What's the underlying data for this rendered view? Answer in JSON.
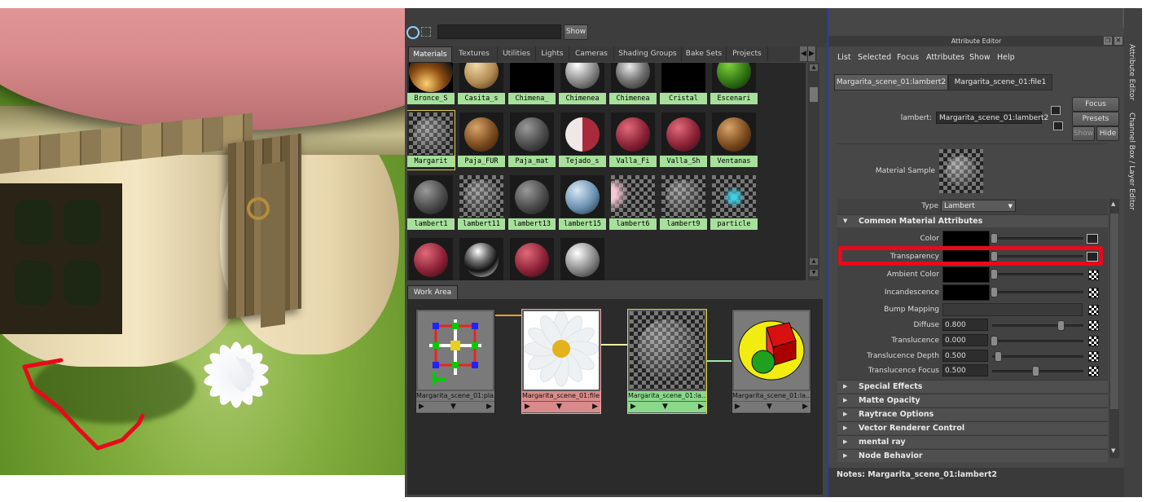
{
  "hypershade": {
    "show_button": "Show",
    "tabs": [
      "Materials",
      "Textures",
      "Utilities",
      "Lights",
      "Cameras",
      "Shading Groups",
      "Bake Sets",
      "Projects"
    ],
    "swatches": [
      {
        "label": "Bronce_S",
        "kind": "bronze"
      },
      {
        "label": "Casita_s",
        "kind": "tan"
      },
      {
        "label": "Chimena_",
        "kind": "black"
      },
      {
        "label": "Chimenea",
        "kind": "stone"
      },
      {
        "label": "Chimenea",
        "kind": "stone2"
      },
      {
        "label": "Cristal",
        "kind": "black"
      },
      {
        "label": "Escenari",
        "kind": "green"
      },
      {
        "label": "Margarit",
        "kind": "checker-ball"
      },
      {
        "label": "Paja_FUR",
        "kind": "wood"
      },
      {
        "label": "Paja_mat",
        "kind": "grey"
      },
      {
        "label": "Tejado_s",
        "kind": "red-white"
      },
      {
        "label": "Valla_Fi",
        "kind": "red"
      },
      {
        "label": "Valla_Sh",
        "kind": "red"
      },
      {
        "label": "Ventanas",
        "kind": "wood"
      },
      {
        "label": "lambert1",
        "kind": "grey"
      },
      {
        "label": "lambert11",
        "kind": "checker"
      },
      {
        "label": "lambert13",
        "kind": "grey"
      },
      {
        "label": "lambert15",
        "kind": "blue"
      },
      {
        "label": "lambert6",
        "kind": "checker-pink"
      },
      {
        "label": "lambert9",
        "kind": "checker"
      },
      {
        "label": "particle",
        "kind": "checker-cyan"
      },
      {
        "label": "",
        "kind": "red"
      },
      {
        "label": "",
        "kind": "chrome"
      },
      {
        "label": "",
        "kind": "red"
      },
      {
        "label": "",
        "kind": "stone"
      }
    ],
    "work_area_tab": "Work Area",
    "nodes": [
      {
        "label": "Margarita_scene_01:pla...",
        "type": "place2d"
      },
      {
        "label": "Margarita_scene_01:file1",
        "type": "file"
      },
      {
        "label": "Margarita_scene_01:la...",
        "type": "lambert"
      },
      {
        "label": "Margarita_scene_01:la...",
        "type": "sg"
      }
    ]
  },
  "attribute_editor": {
    "title": "Attribute Editor",
    "menu": [
      "List",
      "Selected",
      "Focus",
      "Attributes",
      "Show",
      "Help"
    ],
    "tabs": [
      "Margarita_scene_01:lambert2",
      "Margarita_scene_01:file1"
    ],
    "node_label": "lambert:",
    "node_value": "Margarita_scene_01:lambert2",
    "buttons": {
      "focus": "Focus",
      "presets": "Presets",
      "show": "Show",
      "hide": "Hide"
    },
    "material_sample_label": "Material Sample",
    "type_label": "Type",
    "type_value": "Lambert",
    "common_section": "Common Material Attributes",
    "attributes": {
      "color": "Color",
      "transparency": "Transparency",
      "ambient": "Ambient Color",
      "incandescence": "Incandescence",
      "bump": "Bump Mapping",
      "diffuse": "Diffuse",
      "diffuse_value": "0.800",
      "translucence": "Translucence",
      "translucence_value": "0.000",
      "trans_depth": "Translucence Depth",
      "trans_depth_value": "0.500",
      "trans_focus": "Translucence Focus",
      "trans_focus_value": "0.500"
    },
    "slider_levels": {
      "diffuse": 0.8,
      "translucence": 0.0,
      "trans_depth": 0.05,
      "trans_focus": 0.5
    },
    "sections": [
      "Special Effects",
      "Matte Opacity",
      "Raytrace Options",
      "Vector Renderer Control",
      "mental ray",
      "Node Behavior"
    ],
    "notes": "Notes:  Margarita_scene_01:lambert2"
  },
  "side_tabs": [
    "Attribute Editor",
    "Channel Box / Layer Editor"
  ],
  "colors": {
    "highlight": "#e8091a",
    "divider": "#1d3cc9",
    "swatch_label": "#a7e09b"
  }
}
